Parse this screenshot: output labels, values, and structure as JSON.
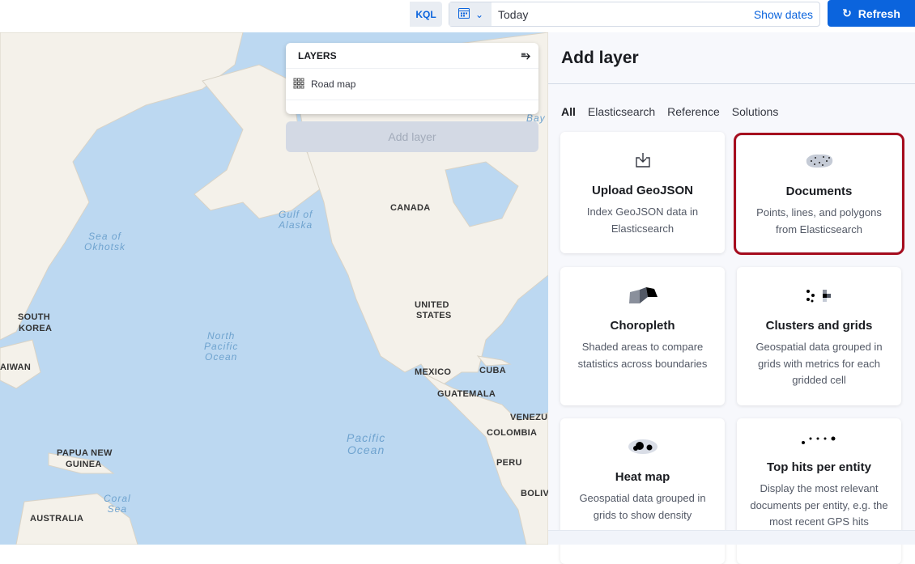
{
  "topbar": {
    "query_language": "KQL",
    "date_value": "Today",
    "show_dates": "Show dates",
    "refresh": "Refresh"
  },
  "map": {
    "layers_title": "LAYERS",
    "layers": [
      {
        "name": "Road map",
        "icon": "grid-icon"
      }
    ],
    "add_layer_button": "Add layer",
    "labels": {
      "canada": "CANADA",
      "us1": "UNITED",
      "us2": "STATES",
      "mexico": "MEXICO",
      "cuba": "CUBA",
      "guatemala": "GUATEMALA",
      "venezuela": "VENEZUE",
      "colombia": "COLOMBIA",
      "peru": "PERU",
      "bolivia": "BOLIV",
      "sk1": "SOUTH",
      "sk2": "KOREA",
      "taiwan": "AIWAN",
      "png1": "PAPUA NEW",
      "png2": "GUINEA",
      "australia": "AUSTRALIA"
    },
    "oceans": {
      "okhotsk1": "Sea of",
      "okhotsk2": "Okhotsk",
      "alaska1": "Gulf of",
      "alaska2": "Alaska",
      "np1": "North",
      "np2": "Pacific",
      "np3": "Ocean",
      "pac1": "Pacific",
      "pac2": "Ocean",
      "coral1": "Coral",
      "coral2": "Sea",
      "bay": "Bay"
    }
  },
  "panel": {
    "title": "Add layer",
    "tabs": [
      "All",
      "Elasticsearch",
      "Reference",
      "Solutions"
    ],
    "active_tab": "All",
    "cards": [
      {
        "title": "Upload GeoJSON",
        "desc": "Index GeoJSON data in Elasticsearch",
        "icon": "upload-icon"
      },
      {
        "title": "Documents",
        "desc": "Points, lines, and polygons from Elasticsearch",
        "icon": "documents-icon",
        "highlighted": true
      },
      {
        "title": "Choropleth",
        "desc": "Shaded areas to compare statistics across boundaries",
        "icon": "choropleth-icon"
      },
      {
        "title": "Clusters and grids",
        "desc": "Geospatial data grouped in grids with metrics for each gridded cell",
        "icon": "clusters-icon"
      },
      {
        "title": "Heat map",
        "desc": "Geospatial data grouped in grids to show density",
        "icon": "heatmap-icon"
      },
      {
        "title": "Top hits per entity",
        "desc": "Display the most relevant documents per entity, e.g. the most recent GPS hits",
        "icon": "top-hits-icon"
      }
    ]
  },
  "colors": {
    "accent": "#0b64dd",
    "highlight": "#a50c1e",
    "water": "#bcd8f1",
    "land": "#f4f1ea"
  }
}
